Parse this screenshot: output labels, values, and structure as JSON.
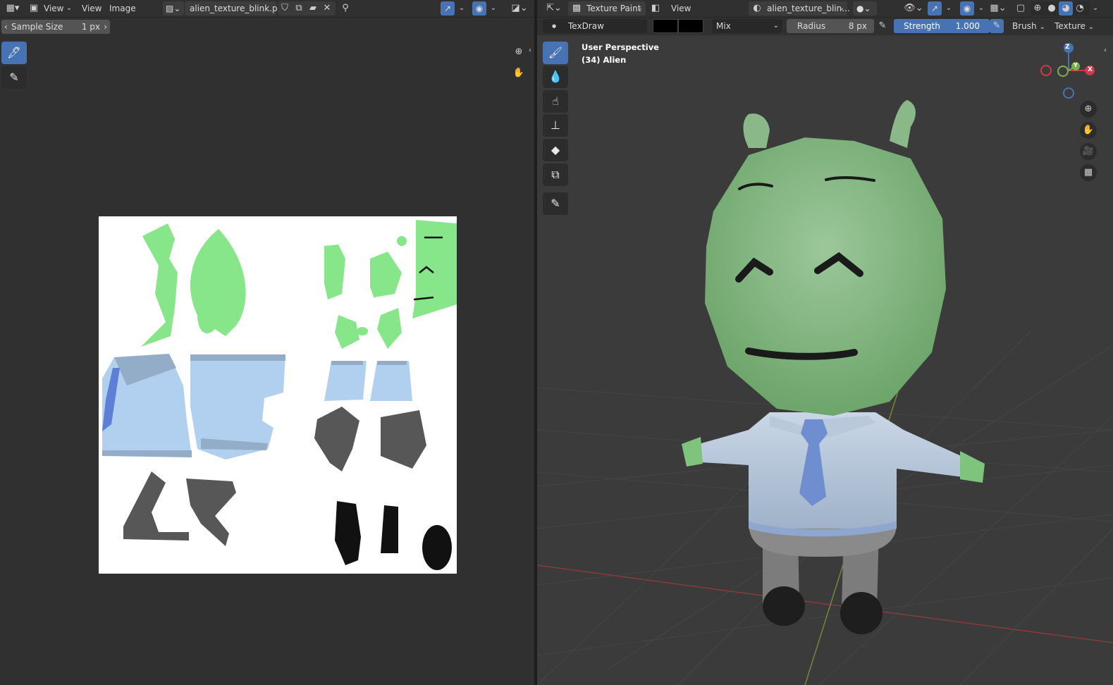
{
  "image_editor": {
    "view_menu_1": "View",
    "view_menu_2": "View",
    "image_menu": "Image",
    "image_name": "alien_texture_blink.png",
    "sample_size_label": "Sample Size",
    "sample_size_value": "1 px"
  },
  "viewport": {
    "mode": "Texture Paint",
    "view_menu": "View",
    "texture_name": "alien_texture_blin...",
    "brush_name": "TexDraw",
    "blend_mode": "Mix",
    "radius_label": "Radius",
    "radius_value": "8 px",
    "strength_label": "Strength",
    "strength_value": "1.000",
    "brush_menu": "Brush",
    "texture_menu": "Texture",
    "perspective_label": "User Perspective",
    "object_label": "(34) Alien",
    "gizmo": {
      "z": "Z",
      "y": "Y",
      "x": "X"
    }
  },
  "colors": {
    "accent": "#4772b3",
    "panel": "#303030",
    "header": "#303030",
    "alien_green": "#8ee48d",
    "shirt_blue": "#b1cfee"
  },
  "icons": [
    "editor-type-icon",
    "image-icon",
    "new-image-icon",
    "open-image-icon",
    "close-icon",
    "pin-icon",
    "shield-icon",
    "sample-tool-icon",
    "annotate-tool-icon",
    "zoom-icon",
    "hand-icon",
    "draw-brush-icon",
    "soften-icon",
    "smear-icon",
    "clone-icon",
    "fill-icon",
    "mask-icon",
    "orbit-icon",
    "camera-icon",
    "grid-icon",
    "eye-icon",
    "overlay-icon",
    "shading-icon"
  ]
}
